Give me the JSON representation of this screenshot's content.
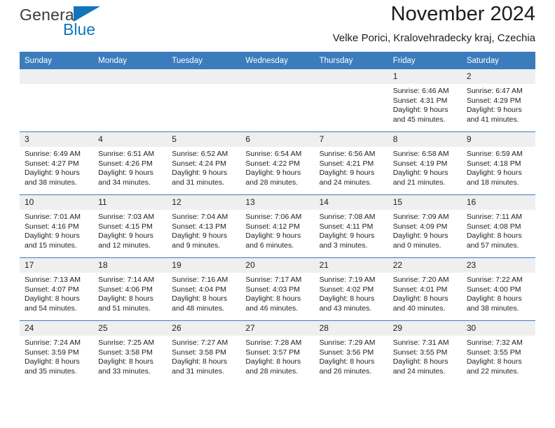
{
  "brand": {
    "line1": "General",
    "line2": "Blue",
    "triangle_color": "#1275bc"
  },
  "header": {
    "title": "November 2024",
    "subtitle": "Velke Porici, Kralovehradecky kraj, Czechia",
    "accent_color": "#3b7cbd"
  },
  "weekday_headers": [
    "Sunday",
    "Monday",
    "Tuesday",
    "Wednesday",
    "Thursday",
    "Friday",
    "Saturday"
  ],
  "weeks": [
    [
      {
        "day": "",
        "empty": true,
        "sunrise": "",
        "sunset": "",
        "daylight1": "",
        "daylight2": ""
      },
      {
        "day": "",
        "empty": true,
        "sunrise": "",
        "sunset": "",
        "daylight1": "",
        "daylight2": ""
      },
      {
        "day": "",
        "empty": true,
        "sunrise": "",
        "sunset": "",
        "daylight1": "",
        "daylight2": ""
      },
      {
        "day": "",
        "empty": true,
        "sunrise": "",
        "sunset": "",
        "daylight1": "",
        "daylight2": ""
      },
      {
        "day": "",
        "empty": true,
        "sunrise": "",
        "sunset": "",
        "daylight1": "",
        "daylight2": ""
      },
      {
        "day": "1",
        "empty": false,
        "sunrise": "Sunrise: 6:46 AM",
        "sunset": "Sunset: 4:31 PM",
        "daylight1": "Daylight: 9 hours",
        "daylight2": "and 45 minutes."
      },
      {
        "day": "2",
        "empty": false,
        "sunrise": "Sunrise: 6:47 AM",
        "sunset": "Sunset: 4:29 PM",
        "daylight1": "Daylight: 9 hours",
        "daylight2": "and 41 minutes."
      }
    ],
    [
      {
        "day": "3",
        "empty": false,
        "sunrise": "Sunrise: 6:49 AM",
        "sunset": "Sunset: 4:27 PM",
        "daylight1": "Daylight: 9 hours",
        "daylight2": "and 38 minutes."
      },
      {
        "day": "4",
        "empty": false,
        "sunrise": "Sunrise: 6:51 AM",
        "sunset": "Sunset: 4:26 PM",
        "daylight1": "Daylight: 9 hours",
        "daylight2": "and 34 minutes."
      },
      {
        "day": "5",
        "empty": false,
        "sunrise": "Sunrise: 6:52 AM",
        "sunset": "Sunset: 4:24 PM",
        "daylight1": "Daylight: 9 hours",
        "daylight2": "and 31 minutes."
      },
      {
        "day": "6",
        "empty": false,
        "sunrise": "Sunrise: 6:54 AM",
        "sunset": "Sunset: 4:22 PM",
        "daylight1": "Daylight: 9 hours",
        "daylight2": "and 28 minutes."
      },
      {
        "day": "7",
        "empty": false,
        "sunrise": "Sunrise: 6:56 AM",
        "sunset": "Sunset: 4:21 PM",
        "daylight1": "Daylight: 9 hours",
        "daylight2": "and 24 minutes."
      },
      {
        "day": "8",
        "empty": false,
        "sunrise": "Sunrise: 6:58 AM",
        "sunset": "Sunset: 4:19 PM",
        "daylight1": "Daylight: 9 hours",
        "daylight2": "and 21 minutes."
      },
      {
        "day": "9",
        "empty": false,
        "sunrise": "Sunrise: 6:59 AM",
        "sunset": "Sunset: 4:18 PM",
        "daylight1": "Daylight: 9 hours",
        "daylight2": "and 18 minutes."
      }
    ],
    [
      {
        "day": "10",
        "empty": false,
        "sunrise": "Sunrise: 7:01 AM",
        "sunset": "Sunset: 4:16 PM",
        "daylight1": "Daylight: 9 hours",
        "daylight2": "and 15 minutes."
      },
      {
        "day": "11",
        "empty": false,
        "sunrise": "Sunrise: 7:03 AM",
        "sunset": "Sunset: 4:15 PM",
        "daylight1": "Daylight: 9 hours",
        "daylight2": "and 12 minutes."
      },
      {
        "day": "12",
        "empty": false,
        "sunrise": "Sunrise: 7:04 AM",
        "sunset": "Sunset: 4:13 PM",
        "daylight1": "Daylight: 9 hours",
        "daylight2": "and 9 minutes."
      },
      {
        "day": "13",
        "empty": false,
        "sunrise": "Sunrise: 7:06 AM",
        "sunset": "Sunset: 4:12 PM",
        "daylight1": "Daylight: 9 hours",
        "daylight2": "and 6 minutes."
      },
      {
        "day": "14",
        "empty": false,
        "sunrise": "Sunrise: 7:08 AM",
        "sunset": "Sunset: 4:11 PM",
        "daylight1": "Daylight: 9 hours",
        "daylight2": "and 3 minutes."
      },
      {
        "day": "15",
        "empty": false,
        "sunrise": "Sunrise: 7:09 AM",
        "sunset": "Sunset: 4:09 PM",
        "daylight1": "Daylight: 9 hours",
        "daylight2": "and 0 minutes."
      },
      {
        "day": "16",
        "empty": false,
        "sunrise": "Sunrise: 7:11 AM",
        "sunset": "Sunset: 4:08 PM",
        "daylight1": "Daylight: 8 hours",
        "daylight2": "and 57 minutes."
      }
    ],
    [
      {
        "day": "17",
        "empty": false,
        "sunrise": "Sunrise: 7:13 AM",
        "sunset": "Sunset: 4:07 PM",
        "daylight1": "Daylight: 8 hours",
        "daylight2": "and 54 minutes."
      },
      {
        "day": "18",
        "empty": false,
        "sunrise": "Sunrise: 7:14 AM",
        "sunset": "Sunset: 4:06 PM",
        "daylight1": "Daylight: 8 hours",
        "daylight2": "and 51 minutes."
      },
      {
        "day": "19",
        "empty": false,
        "sunrise": "Sunrise: 7:16 AM",
        "sunset": "Sunset: 4:04 PM",
        "daylight1": "Daylight: 8 hours",
        "daylight2": "and 48 minutes."
      },
      {
        "day": "20",
        "empty": false,
        "sunrise": "Sunrise: 7:17 AM",
        "sunset": "Sunset: 4:03 PM",
        "daylight1": "Daylight: 8 hours",
        "daylight2": "and 46 minutes."
      },
      {
        "day": "21",
        "empty": false,
        "sunrise": "Sunrise: 7:19 AM",
        "sunset": "Sunset: 4:02 PM",
        "daylight1": "Daylight: 8 hours",
        "daylight2": "and 43 minutes."
      },
      {
        "day": "22",
        "empty": false,
        "sunrise": "Sunrise: 7:20 AM",
        "sunset": "Sunset: 4:01 PM",
        "daylight1": "Daylight: 8 hours",
        "daylight2": "and 40 minutes."
      },
      {
        "day": "23",
        "empty": false,
        "sunrise": "Sunrise: 7:22 AM",
        "sunset": "Sunset: 4:00 PM",
        "daylight1": "Daylight: 8 hours",
        "daylight2": "and 38 minutes."
      }
    ],
    [
      {
        "day": "24",
        "empty": false,
        "sunrise": "Sunrise: 7:24 AM",
        "sunset": "Sunset: 3:59 PM",
        "daylight1": "Daylight: 8 hours",
        "daylight2": "and 35 minutes."
      },
      {
        "day": "25",
        "empty": false,
        "sunrise": "Sunrise: 7:25 AM",
        "sunset": "Sunset: 3:58 PM",
        "daylight1": "Daylight: 8 hours",
        "daylight2": "and 33 minutes."
      },
      {
        "day": "26",
        "empty": false,
        "sunrise": "Sunrise: 7:27 AM",
        "sunset": "Sunset: 3:58 PM",
        "daylight1": "Daylight: 8 hours",
        "daylight2": "and 31 minutes."
      },
      {
        "day": "27",
        "empty": false,
        "sunrise": "Sunrise: 7:28 AM",
        "sunset": "Sunset: 3:57 PM",
        "daylight1": "Daylight: 8 hours",
        "daylight2": "and 28 minutes."
      },
      {
        "day": "28",
        "empty": false,
        "sunrise": "Sunrise: 7:29 AM",
        "sunset": "Sunset: 3:56 PM",
        "daylight1": "Daylight: 8 hours",
        "daylight2": "and 26 minutes."
      },
      {
        "day": "29",
        "empty": false,
        "sunrise": "Sunrise: 7:31 AM",
        "sunset": "Sunset: 3:55 PM",
        "daylight1": "Daylight: 8 hours",
        "daylight2": "and 24 minutes."
      },
      {
        "day": "30",
        "empty": false,
        "sunrise": "Sunrise: 7:32 AM",
        "sunset": "Sunset: 3:55 PM",
        "daylight1": "Daylight: 8 hours",
        "daylight2": "and 22 minutes."
      }
    ]
  ]
}
